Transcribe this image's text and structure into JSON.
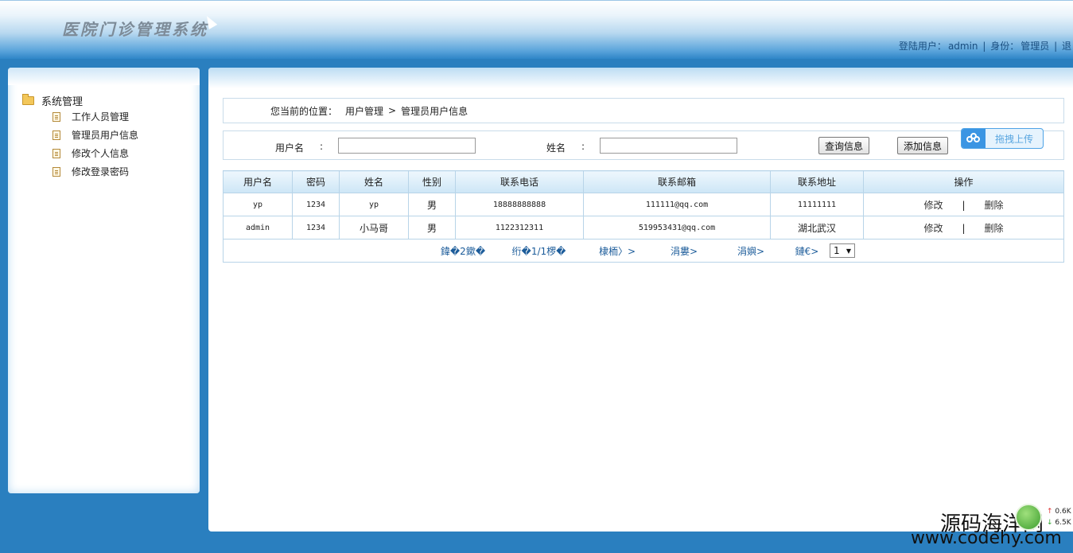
{
  "header": {
    "logo": "医院门诊管理系统",
    "user_label": "登陆用户：",
    "user_name": "admin",
    "sep1": "|",
    "role_label": "身份：",
    "role_name": "管理员",
    "sep2": "|",
    "logout": "退"
  },
  "sidebar": {
    "root": "系统管理",
    "items": [
      {
        "label": "工作人员管理"
      },
      {
        "label": "管理员用户信息"
      },
      {
        "label": "修改个人信息"
      },
      {
        "label": "修改登录密码"
      }
    ]
  },
  "breadcrumb": {
    "prefix": "您当前的位置：",
    "level1": "用户管理",
    "sep": ">",
    "level2": "管理员用户信息"
  },
  "search": {
    "username_label": "用户名",
    "username_colon": ":",
    "username_value": "",
    "name_label": "姓名",
    "name_colon": ":",
    "name_value": "",
    "query_button": "查询信息",
    "add_button": "添加信息",
    "upload_button": "拖拽上传"
  },
  "table": {
    "columns": [
      "用户名",
      "密码",
      "姓名",
      "性别",
      "联系电话",
      "联系邮箱",
      "联系地址",
      "操作"
    ],
    "rows": [
      {
        "username": "yp",
        "password": "1234",
        "name": "yp",
        "gender": "男",
        "phone": "18888888888",
        "email": "111111@qq.com",
        "address": "11111111",
        "edit": "修改",
        "sep": "|",
        "delete": "删除"
      },
      {
        "username": "admin",
        "password": "1234",
        "name": "小马哥",
        "gender": "男",
        "phone": "1122312311",
        "email": "519953431@qq.com",
        "address": "湖北武汉",
        "edit": "修改",
        "sep": "|",
        "delete": "删除"
      }
    ]
  },
  "pager": {
    "total": "鍏�2鏉�",
    "page_info": "绗�1/1椤�",
    "first": "棣栭〉>",
    "prev": "涓婁>",
    "next": "涓嬩>",
    "last": "鏈€>",
    "selected": "1",
    "arrow": "▼"
  },
  "watermark": {
    "title": "源码海洋网",
    "url": "www.codehy.com",
    "net_up": "0.6K",
    "net_down": "6.5K",
    "up_arrow": "↑",
    "down_arrow": "↓"
  }
}
